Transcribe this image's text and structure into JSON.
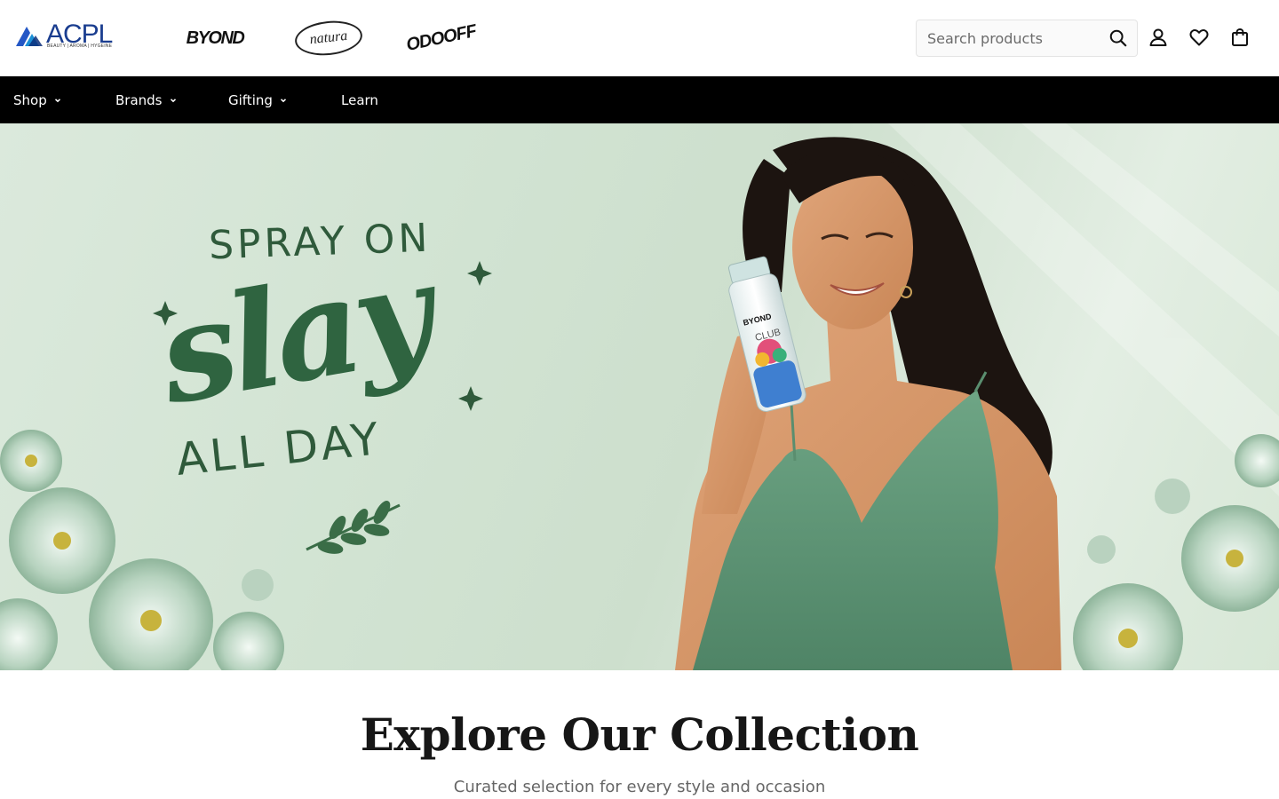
{
  "header": {
    "logo": {
      "name": "ACPL",
      "tagline": "BEAUTY | AROMA | HYGEINE"
    },
    "brand_logos": [
      {
        "name": "BYOND"
      },
      {
        "name": "natura"
      },
      {
        "name": "ODOOFF"
      }
    ],
    "search": {
      "placeholder": "Search products",
      "value": ""
    },
    "icons": [
      "search-icon",
      "user-icon",
      "heart-icon",
      "bag-icon"
    ]
  },
  "nav": {
    "items": [
      {
        "label": "Shop",
        "has_dropdown": true
      },
      {
        "label": "Brands",
        "has_dropdown": true
      },
      {
        "label": "Gifting",
        "has_dropdown": true
      },
      {
        "label": "Learn",
        "has_dropdown": false
      }
    ]
  },
  "hero": {
    "line1": "SPRAY ON",
    "line2": "slay",
    "line3": "ALL DAY",
    "product_brand": "BYOND",
    "product_name": "CLUB"
  },
  "collection": {
    "title": "Explore Our Collection",
    "subtitle": "Curated selection for every style and occasion"
  },
  "colors": {
    "nav_bg": "#000000",
    "hero_bg": "#d3e5d4",
    "hero_text": "#2f6440",
    "dress": "#5e9474"
  }
}
